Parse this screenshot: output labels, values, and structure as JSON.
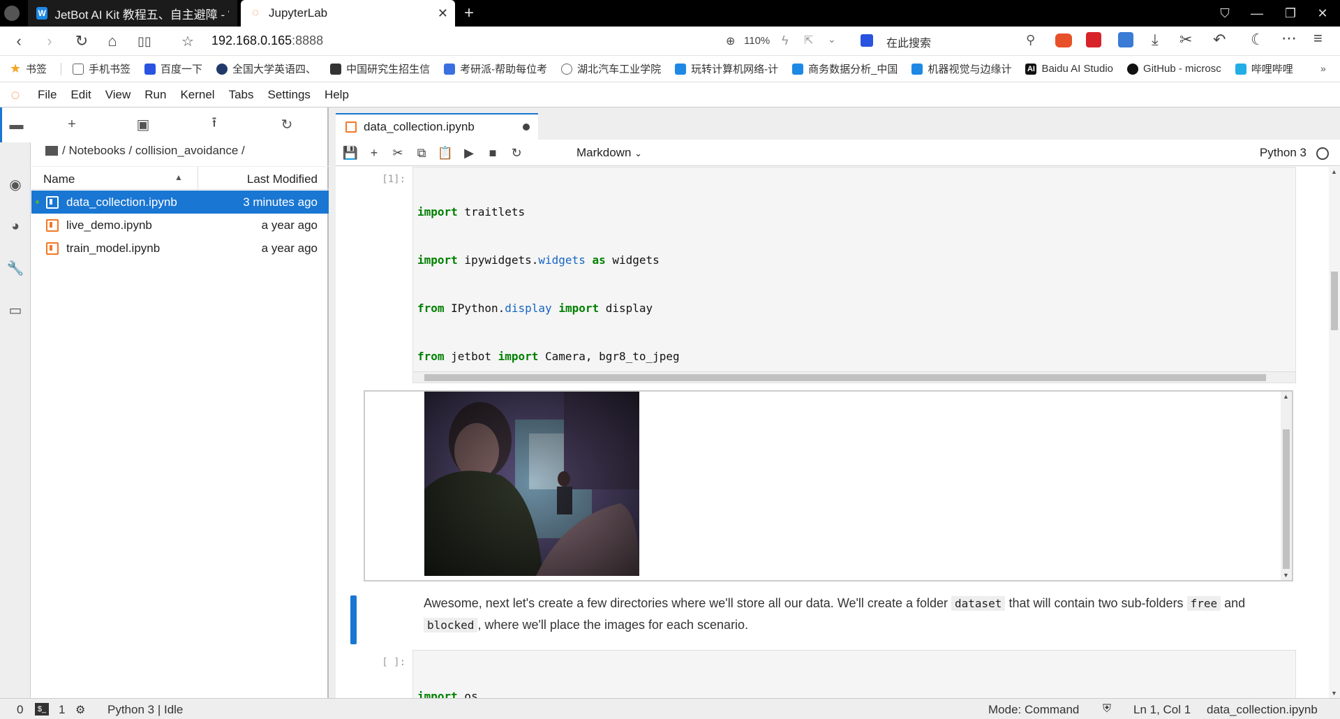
{
  "browser": {
    "tabs": [
      {
        "title": "JetBot AI Kit 教程五、自主避障 - Wa",
        "icon": "wiki-icon"
      },
      {
        "title": "JupyterLab",
        "icon": "jupyter-icon"
      }
    ],
    "url_host": "192.168.0.165",
    "url_port": ":8888",
    "zoom": "110%",
    "search_placeholder": "在此搜索",
    "bookmarks": [
      "书签",
      "手机书签",
      "百度一下",
      "全国大学英语四、",
      "中国研究生招生信",
      "考研派-帮助每位考",
      "湖北汽车工业学院",
      "玩转计算机网络-计",
      "商务数据分析_中国",
      "机器视觉与边缘计",
      "Baidu AI Studio",
      "GitHub - microsc",
      "哔哩哔哩"
    ]
  },
  "menu": [
    "File",
    "Edit",
    "View",
    "Run",
    "Kernel",
    "Tabs",
    "Settings",
    "Help"
  ],
  "filebrowser": {
    "breadcrumb": "/ Notebooks / collision_avoidance /",
    "col_name": "Name",
    "col_modified": "Last Modified",
    "files": [
      {
        "name": "data_collection.ipynb",
        "modified": "3 minutes ago",
        "selected": true,
        "running": true
      },
      {
        "name": "live_demo.ipynb",
        "modified": "a year ago",
        "selected": false,
        "running": false
      },
      {
        "name": "train_model.ipynb",
        "modified": "a year ago",
        "selected": false,
        "running": false
      }
    ]
  },
  "notebook": {
    "tab_title": "data_collection.ipynb",
    "cell_type": "Markdown",
    "kernel": "Python 3",
    "cell1_prompt": "[1]:",
    "cell3_prompt": "[ ]:",
    "markdown_text_parts": [
      "Awesome, next let's create a few directories where we'll store all our data. We'll create a folder ",
      "dataset",
      " that will contain two sub-folders ",
      "free",
      " and ",
      "blocked",
      ", where we'll place the images for each scenario."
    ],
    "cell3_code": "import os"
  },
  "status": {
    "terminals": "0",
    "kernels": "1",
    "kernel_state": "Python 3 | Idle",
    "mode": "Mode: Command",
    "position": "Ln 1, Col 1",
    "filename": "data_collection.ipynb"
  }
}
